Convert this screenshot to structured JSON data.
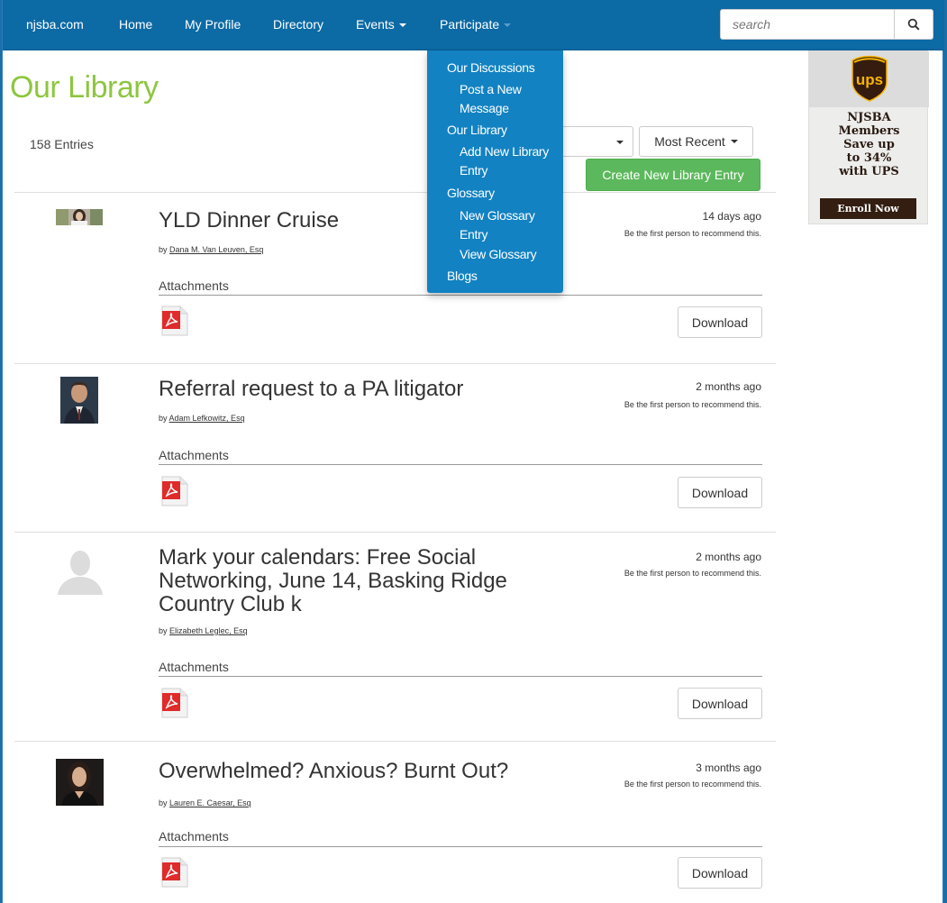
{
  "nav": {
    "brand": "njsba.com",
    "home": "Home",
    "profile": "My Profile",
    "directory": "Directory",
    "events": "Events",
    "participate": "Participate",
    "search_placeholder": "search"
  },
  "dropdown": {
    "discussions": "Our Discussions",
    "post_message_1": "Post a New",
    "post_message_2": "Message",
    "library": "Our Library",
    "add_library_1": "Add New Library",
    "add_library_2": "Entry",
    "glossary": "Glossary",
    "new_glossary_1": "New Glossary",
    "new_glossary_2": "Entry",
    "view_glossary": "View Glossary",
    "blogs": "Blogs"
  },
  "page": {
    "title": "Our Library",
    "entries_count": "158 Entries",
    "sort_label": "Most Recent",
    "create_label": "Create New Library Entry"
  },
  "entries": [
    {
      "title": "YLD Dinner Cruise",
      "by": "by",
      "author": "Dana M. Van Leuven, Esq",
      "time": "14 days ago",
      "rec": "Be the first person to recommend this.",
      "attachments": "Attachments",
      "download": "Download"
    },
    {
      "title": "Referral request to a PA litigator",
      "by": "by",
      "author": "Adam Lefkowitz, Esq",
      "time": "2 months ago",
      "rec": "Be the first person to recommend this.",
      "attachments": "Attachments",
      "download": "Download"
    },
    {
      "title": "Mark your calendars: Free Social Networking, June 14, Basking Ridge Country Club k",
      "by": "by",
      "author": "Elizabeth Leglec, Esq",
      "time": "2 months ago",
      "rec": "Be the first person to recommend this.",
      "attachments": "Attachments",
      "download": "Download"
    },
    {
      "title": "Overwhelmed? Anxious? Burnt Out?",
      "by": "by",
      "author": "Lauren E. Caesar, Esq",
      "time": "3 months ago",
      "rec": "Be the first person to recommend this.",
      "attachments": "Attachments",
      "download": "Download"
    }
  ],
  "ad": {
    "logo": "ups",
    "line1": "NJSBA",
    "line2": "Members",
    "line3": "Save up",
    "line4": "to 34%",
    "line5": "with UPS",
    "cta": "Enroll Now"
  },
  "colors": {
    "navbar": "#0c6aa5",
    "dropdown": "#1282c2",
    "title_green": "#8dc63f",
    "create_green": "#5cb85c",
    "pdf_red": "#e02b2b",
    "ups_brown": "#351c0f",
    "ups_gold": "#f7b500"
  }
}
